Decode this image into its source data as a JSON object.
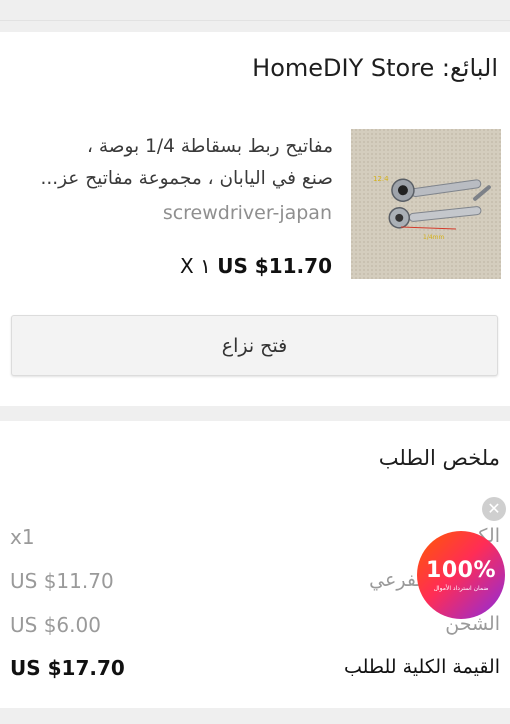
{
  "seller": {
    "label": "البائع: HomeDIY Store"
  },
  "product": {
    "title_line1": "مفاتيح ربط بسقاطة 1/4 بوصة ،",
    "title_line2": "صنع في اليابان ، مجموعة مفاتيح عز...",
    "sku": "screwdriver-japan",
    "quantity_prefix": "X ١",
    "price": "US $11.70",
    "image_labels": {
      "tag1": "12.4",
      "tag2": "1/4mm"
    }
  },
  "dispute_button": {
    "label": "فتح نزاع"
  },
  "order_summary": {
    "title": "ملخص الطلب",
    "rows": [
      {
        "label": "الكمية",
        "value": "x1"
      },
      {
        "label": "المجموع الفرعي",
        "value": "US $11.70"
      },
      {
        "label": "الشحن",
        "value": "US $6.00"
      }
    ],
    "total": {
      "label": "القيمة الكلية للطلب",
      "value": "US $17.70"
    }
  },
  "promo_badge": {
    "percent": "100%",
    "subtitle": "ضمان استرداد الأموال"
  },
  "colors": {
    "badge_start": "#ff5a00",
    "badge_mid": "#ff2d55",
    "badge_end": "#8a2be2"
  }
}
